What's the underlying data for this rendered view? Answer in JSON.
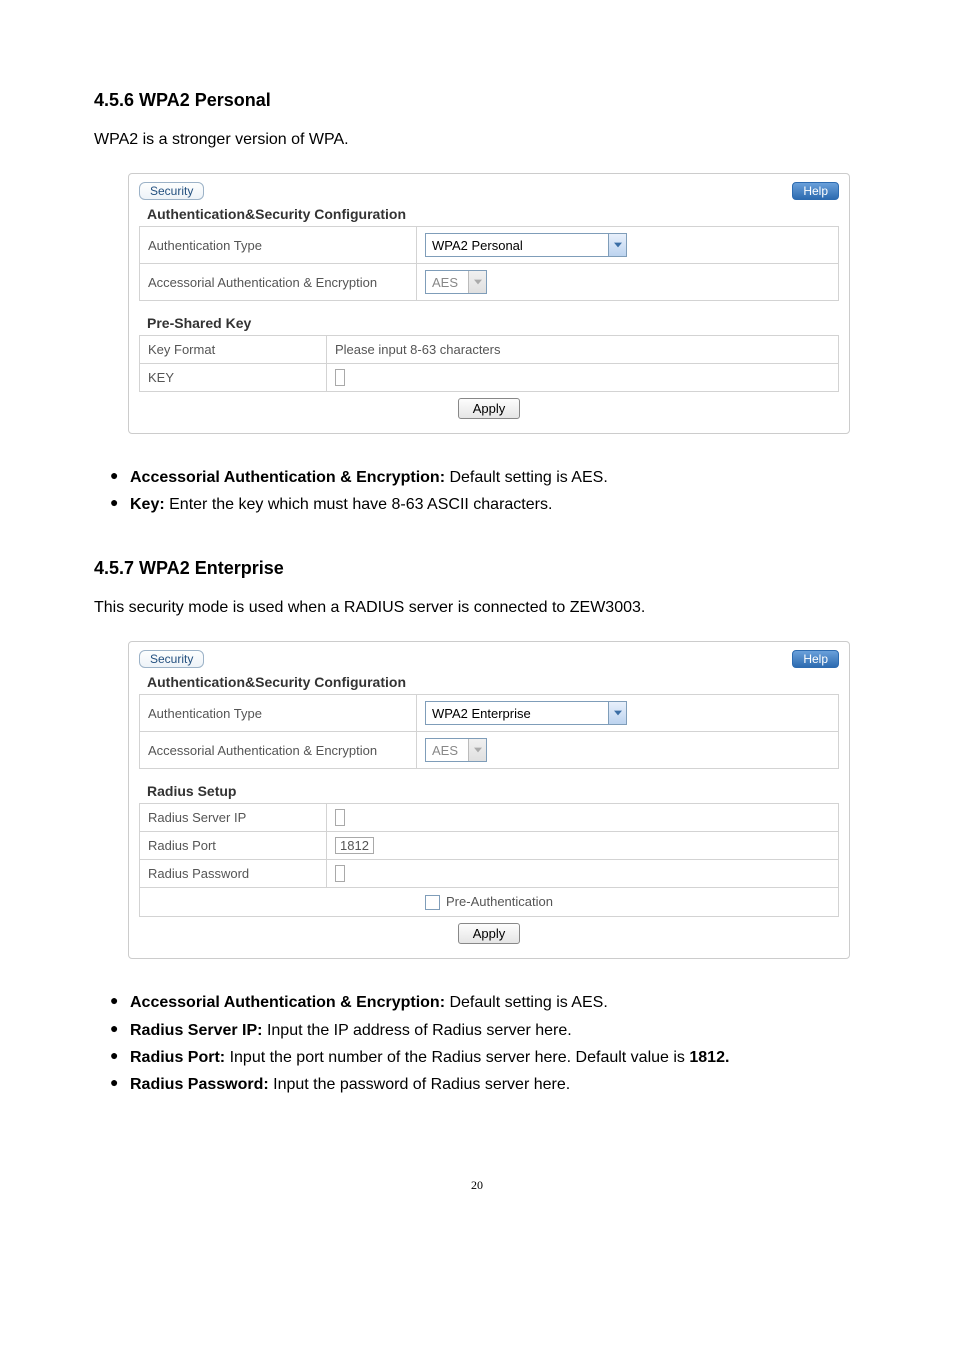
{
  "sec456": {
    "heading": "4.5.6 WPA2 Personal",
    "intro": "WPA2 is a stronger version of WPA.",
    "bullets": [
      {
        "term": "Accessorial Authentication & Encryption:",
        "desc": " Default setting is AES."
      },
      {
        "term": "Key:",
        "desc": " Enter the key which must have 8-63 ASCII characters."
      }
    ]
  },
  "sec457": {
    "heading": "4.5.7 WPA2 Enterprise",
    "intro": "This security mode is used when a RADIUS server is connected to ZEW3003.",
    "bullets": [
      {
        "term": "Accessorial Authentication & Encryption:",
        "desc": " Default setting is AES."
      },
      {
        "term": "Radius Server IP:",
        "desc": " Input the IP address of Radius server here."
      },
      {
        "term": "Radius Port:",
        "desc": " Input the port number of the Radius server here. Default value is ",
        "term2": "1812."
      },
      {
        "term": "Radius Password:",
        "desc": "  Input the password of Radius server here."
      }
    ]
  },
  "panel1": {
    "tab": "Security",
    "help": "Help",
    "section1": "Authentication&Security Configuration",
    "row_auth_label": "Authentication Type",
    "row_auth_value": "WPA2 Personal",
    "row_enc_label": "Accessorial Authentication & Encryption",
    "row_enc_value": "AES",
    "psk_heading": "Pre-Shared Key",
    "keyformat_label": "Key Format",
    "keyformat_value": "Please input 8-63 characters",
    "key_label": "KEY",
    "apply": "Apply"
  },
  "panel2": {
    "tab": "Security",
    "help": "Help",
    "section1": "Authentication&Security Configuration",
    "row_auth_label": "Authentication Type",
    "row_auth_value": "WPA2 Enterprise",
    "row_enc_label": "Accessorial Authentication & Encryption",
    "row_enc_value": "AES",
    "radius_heading": "Radius Setup",
    "radius_ip_label": "Radius Server IP",
    "radius_port_label": "Radius Port",
    "radius_port_value": "1812",
    "radius_pw_label": "Radius Password",
    "preauth_label": "Pre-Authentication",
    "apply": "Apply"
  },
  "pagenum": "20"
}
